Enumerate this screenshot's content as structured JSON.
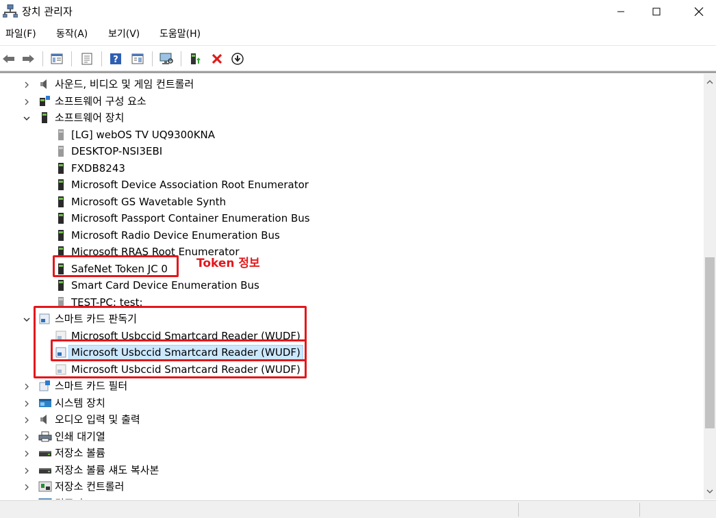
{
  "window": {
    "title": "장치 관리자",
    "controls": {
      "minimize": "minimize",
      "maximize": "maximize",
      "close": "close"
    }
  },
  "menu": [
    "파일(F)",
    "동작(A)",
    "보기(V)",
    "도움말(H)"
  ],
  "toolbar": {
    "icons": [
      "back-icon",
      "forward-icon",
      "show-hide-tree-icon",
      "properties-icon",
      "help-icon",
      "view-icon",
      "monitor-scan-icon",
      "update-driver-icon",
      "uninstall-device-icon",
      "disable-device-icon"
    ]
  },
  "tree": [
    {
      "label": "사운드, 비디오 및 게임 컨트롤러",
      "expanded": false,
      "icon": "speaker-icon"
    },
    {
      "label": "소프트웨어 구성 요소",
      "expanded": false,
      "icon": "software-component-icon"
    },
    {
      "label": "소프트웨어 장치",
      "expanded": true,
      "icon": "software-device-icon"
    },
    {
      "label": "[LG] webOS TV UQ9300KNA",
      "icon": "software-device-grey-icon"
    },
    {
      "label": "DESKTOP-NSI3EBI",
      "icon": "software-device-grey-icon"
    },
    {
      "label": "FXDB8243",
      "icon": "software-device-icon"
    },
    {
      "label": "Microsoft Device Association Root Enumerator",
      "icon": "software-device-icon"
    },
    {
      "label": "Microsoft GS Wavetable Synth",
      "icon": "software-device-icon"
    },
    {
      "label": "Microsoft Passport Container Enumeration Bus",
      "icon": "software-device-icon"
    },
    {
      "label": "Microsoft Radio Device Enumeration Bus",
      "icon": "software-device-icon"
    },
    {
      "label": "Microsoft RRAS Root Enumerator",
      "icon": "software-device-icon"
    },
    {
      "label": "SafeNet Token JC 0",
      "icon": "software-device-icon"
    },
    {
      "label": "Smart Card Device Enumeration Bus",
      "icon": "software-device-icon"
    },
    {
      "label": "TEST-PC: test:",
      "icon": "software-device-grey-icon"
    },
    {
      "label": "스마트 카드 판독기",
      "expanded": true,
      "icon": "smartcard-reader-icon"
    },
    {
      "label": "Microsoft Usbccid Smartcard Reader (WUDF)",
      "icon": "smartcard-reader-grey-icon"
    },
    {
      "label": "Microsoft Usbccid Smartcard Reader (WUDF)",
      "icon": "smartcard-reader-icon",
      "selected": true
    },
    {
      "label": "Microsoft Usbccid Smartcard Reader (WUDF)",
      "icon": "smartcard-reader-grey-icon"
    },
    {
      "label": "스마트 카드 필터",
      "expanded": false,
      "icon": "smartcard-filter-icon"
    },
    {
      "label": "시스템 장치",
      "expanded": false,
      "icon": "system-device-icon"
    },
    {
      "label": "오디오 입력 및 출력",
      "expanded": false,
      "icon": "speaker-icon"
    },
    {
      "label": "인쇄 대기열",
      "expanded": false,
      "icon": "printer-icon"
    },
    {
      "label": "저장소 볼륨",
      "expanded": false,
      "icon": "storage-volume-icon"
    },
    {
      "label": "저장소 볼륨 섀도 복사본",
      "expanded": false,
      "icon": "storage-volume-icon"
    },
    {
      "label": "저장소 컨트롤러",
      "expanded": false,
      "icon": "storage-controller-icon"
    },
    {
      "label": "컴퓨터",
      "expanded": false,
      "icon": "computer-icon"
    }
  ],
  "annotation": {
    "text": "Token 정보",
    "color": "#e3171b"
  },
  "colors": {
    "selection": "#cce8ff",
    "annotation": "#e3171b"
  }
}
